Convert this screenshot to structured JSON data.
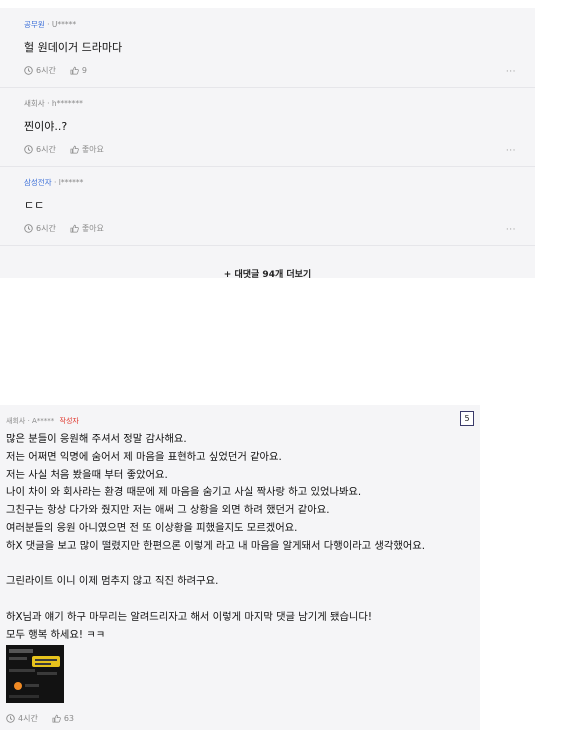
{
  "comments": [
    {
      "company": "공무원",
      "user": "U*****",
      "text": "헐 원데이거 드라마다",
      "time": "6시간",
      "likes": "9",
      "more": "···"
    },
    {
      "company": "새회사",
      "user": "h*******",
      "text": "찐이야..?",
      "time": "6시간",
      "likes": "좋아요",
      "more": "···"
    },
    {
      "company": "삼성전자",
      "user": "l******",
      "text": "ㄷㄷ",
      "time": "6시간",
      "likes": "좋아요",
      "more": "···"
    }
  ],
  "more_comments_label": "+ 대댓글 94개 더보기",
  "post": {
    "company": "새회사",
    "user": "A*****",
    "author_tag": "작성자",
    "badge": "5",
    "lines": [
      "많은 분들이 응원해 주셔서 정말 감사해요.",
      "저는 어쩌면 익명에 숨어서 제 마음을 표현하고 싶었던거 같아요.",
      "저는 사실 처음 봤을때 부터 좋았어요.",
      "나이 차이 와 회사라는 환경 때문에 제 마음을 숨기고 사실 짝사랑 하고 있었나봐요.",
      "그친구는 항상 다가와 줬지만 저는 애써 그 상황을 외면 하려 했던거 같아요.",
      "여러분들의 응원 아니였으면 전 또 이상황을 피했을지도 모르겠어요.",
      "하X 댓글을 보고 많이 떨렸지만 한편으론 이렇게 라고 내 마음을 알게돼서 다행이라고 생각했어요.",
      "",
      "그린라이트 이니 이제 멈추지 않고 직진 하려구요.",
      "",
      "하X님과 얘기 하구 마무리는 알려드리자고 해서 이렇게 마지막 댓글 남기게 됐습니다!",
      "모두 행복 하세요! ㅋㅋ"
    ],
    "time": "4시간",
    "likes": "63"
  },
  "colors": {
    "panel_bg": "#f5f5f7",
    "company_link": "#3b6fd8",
    "author_tag": "#e0362c"
  },
  "icons": {
    "time": "clock-icon",
    "like": "thumbs-up-icon",
    "more": "more-dots-icon"
  }
}
